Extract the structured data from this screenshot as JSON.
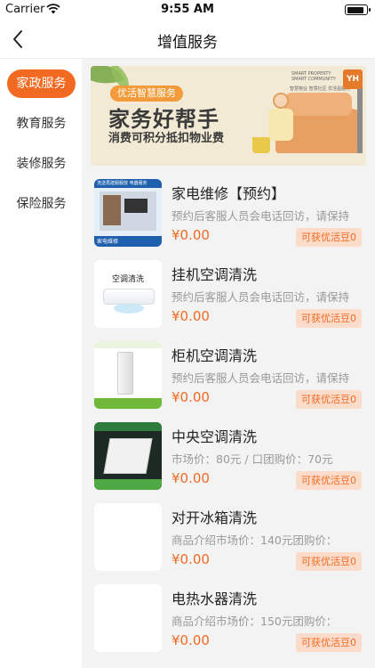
{
  "status_bar": {
    "carrier": "Carrier",
    "time": "9:55 AM",
    "battery_level": 0.9
  },
  "nav": {
    "title": "增值服务"
  },
  "sidebar": {
    "items": [
      {
        "label": "家政服务",
        "active": true
      },
      {
        "label": "教育服务",
        "active": false
      },
      {
        "label": "装修服务",
        "active": false
      },
      {
        "label": "保险服务",
        "active": false
      }
    ]
  },
  "banner": {
    "tag": "优活智慧服务",
    "title": "家务好帮手",
    "subtitle": "消费可积分抵扣物业费",
    "logo_text_en": "SMART PROPERTY SMART COMMUNITY",
    "logo_text_cn": "智慧物业 智慧社区 优活盈服务",
    "logo_mark": "YH"
  },
  "services": [
    {
      "name": "家电维修【预约】",
      "desc": "预约后客服人员会电话回访，请保持",
      "price": "¥0.00",
      "badge": "可获优活豆0",
      "thumb": "appliance-repair",
      "thumb_top": "洗送再建服服放 电器服务",
      "thumb_bottom": "家电维修"
    },
    {
      "name": "挂机空调清洗",
      "desc": "预约后客服人员会电话回访，请保持",
      "price": "¥0.00",
      "badge": "可获优活豆0",
      "thumb": "wall-ac",
      "thumb_label": "空调清洗"
    },
    {
      "name": "柜机空调清洗",
      "desc": "预约后客服人员会电话回访，请保持",
      "price": "¥0.00",
      "badge": "可获优活豆0",
      "thumb": "cabinet-ac"
    },
    {
      "name": "中央空调清洗",
      "desc": "市场价：80元 / 口团购价：70元",
      "price": "¥0.00",
      "badge": "可获优活豆0",
      "thumb": "central-ac"
    },
    {
      "name": "对开冰箱清洗",
      "desc": "商品介绍市场价：140元团购价：",
      "price": "¥0.00",
      "badge": "可获优活豆0",
      "thumb": "blank"
    },
    {
      "name": "电热水器清洗",
      "desc": "商品介绍市场价：150元团购价：",
      "price": "¥0.00",
      "badge": "可获优活豆0",
      "thumb": "blank"
    }
  ]
}
